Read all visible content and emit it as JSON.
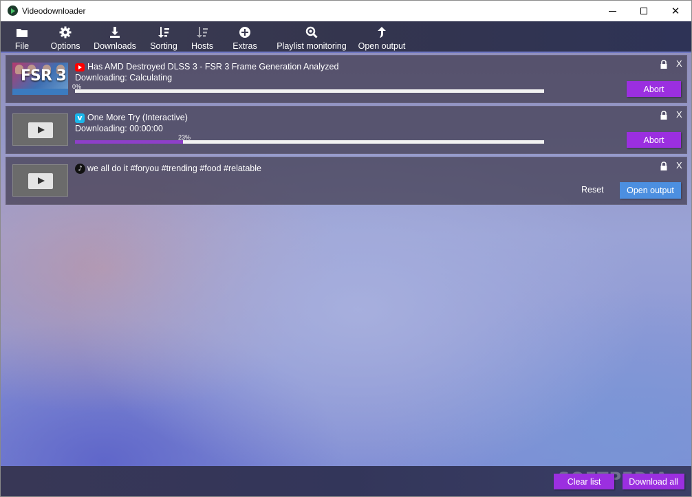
{
  "window": {
    "title": "Videodownloader",
    "controls": {
      "minimize": "minimize-icon",
      "maximize": "maximize-icon",
      "close": "✕"
    }
  },
  "toolbar": {
    "items": [
      {
        "label": "File",
        "icon": "folder-icon"
      },
      {
        "label": "Options",
        "icon": "gear-icon"
      },
      {
        "label": "Downloads",
        "icon": "download-icon"
      },
      {
        "label": "Sorting",
        "icon": "sort-icon"
      },
      {
        "label": "Hosts",
        "icon": "hosts-icon"
      },
      {
        "label": "Extras",
        "icon": "plus-circle-icon"
      },
      {
        "label": "Playlist monitoring",
        "icon": "magnifier-icon"
      },
      {
        "label": "Open output",
        "icon": "arrow-up-icon"
      }
    ]
  },
  "downloads": [
    {
      "site": "youtube",
      "title": "Has AMD Destroyed DLSS 3 - FSR 3 Frame Generation Analyzed",
      "thumbnail_text": "FSR 3",
      "status": "Downloading: Calculating",
      "progress_label": "0%",
      "progress": 0.0,
      "action": "Abort",
      "close": "X"
    },
    {
      "site": "vimeo",
      "site_glyph": "v",
      "title": "One More Try (Interactive)",
      "status": "Downloading: 00:00:00",
      "progress_label": "23%",
      "progress": 0.23,
      "action": "Abort",
      "close": "X"
    },
    {
      "site": "tiktok",
      "site_glyph": "♪",
      "title": "we all do it #foryou #trending #food #relatable",
      "reset": "Reset",
      "action": "Open output",
      "close": "X"
    }
  ],
  "footer": {
    "clear": "Clear list",
    "download_all": "Download all",
    "watermark": "SOFTPEDIA"
  },
  "colors": {
    "accent_purple": "#9b2fe0",
    "open_output_blue": "#4c8fe0",
    "progress_fill": "#8e3fc9"
  }
}
